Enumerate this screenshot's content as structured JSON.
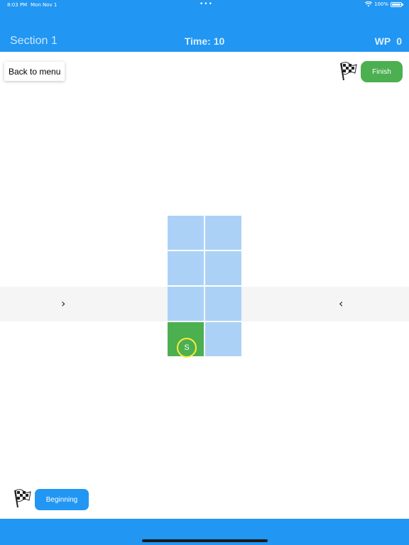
{
  "status_bar": {
    "time": "8:03 PM",
    "date": "Mon Nov 1",
    "dots": "•••",
    "battery": "100%",
    "wifi_icon": "wifi-icon",
    "battery_icon": "battery-icon"
  },
  "app_bar": {
    "section": "Section 1",
    "time": "Time: 10",
    "wp_label": "WP",
    "wp_value": "0",
    "color": "#2196f3"
  },
  "controls": {
    "back": "Back to menu",
    "finish": "Finish",
    "beginning": "Beginning",
    "finish_color": "#4caf50",
    "beginning_color": "#2196f3",
    "flag_icon": "checkered-flag-icon"
  },
  "navigation": {
    "left_arrow": "›",
    "right_arrow": "‹"
  },
  "board": {
    "columns": 2,
    "rows": 4,
    "cell_color": "#abd2f6",
    "start_color": "#4caf50",
    "marker_color": "#ffeb3b",
    "start_cell": {
      "row": 3,
      "col": 0
    },
    "start_label": "S"
  }
}
